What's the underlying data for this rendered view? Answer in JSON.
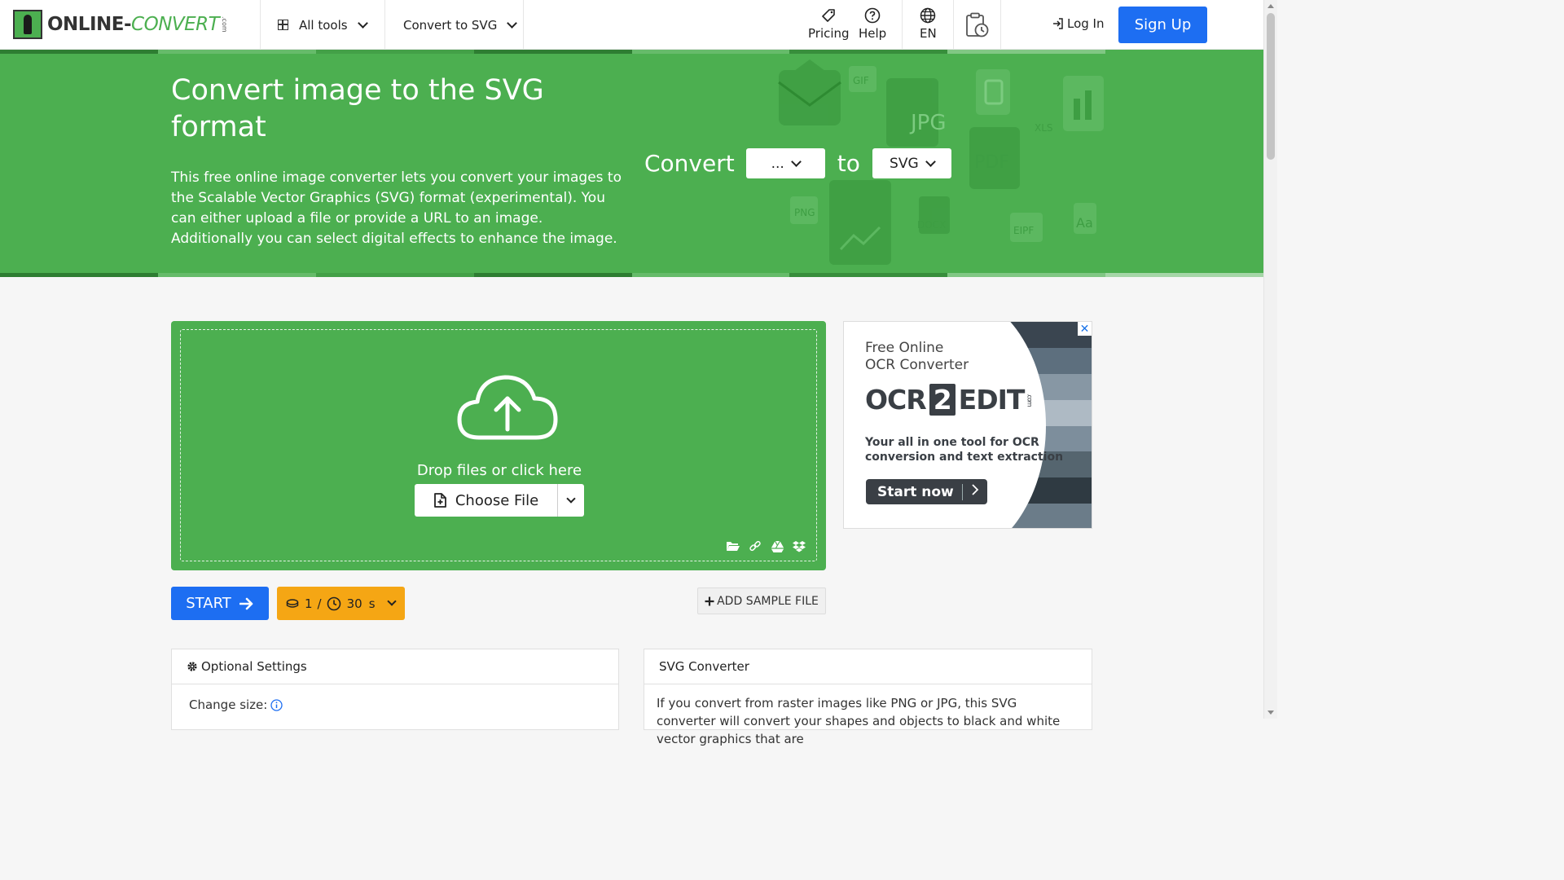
{
  "header": {
    "logo_text_a": "ONLINE-",
    "logo_text_b": "CONVERT",
    "logo_com": ".com",
    "all_tools": "All tools",
    "convert_to": "Convert to SVG",
    "pricing": "Pricing",
    "help": "Help",
    "language": "EN",
    "login": "Log In",
    "signup": "Sign Up"
  },
  "hero": {
    "title": "Convert image to the SVG format",
    "description": "This free online image converter lets you convert your images to the Scalable Vector Graphics (SVG) format (experimental). You can either upload a file or provide a URL to an image. Additionally you can select digital effects to enhance the image.",
    "convert_label": "Convert",
    "from_value": "...",
    "to_label": "to",
    "to_value": "SVG",
    "deco_labels": [
      "GIF",
      "JPG",
      "XLS",
      "PDF",
      "PNG",
      "DOCX",
      "EIPF",
      "Aa"
    ],
    "bg_color": "#4caf50"
  },
  "upload": {
    "drop_text": "Drop files or click here",
    "choose_file": "Choose File"
  },
  "ad": {
    "top_line1": "Free Online",
    "top_line2": "OCR Converter",
    "brand_a": "OCR",
    "brand_b": "2",
    "brand_c": "EDIT",
    "brand_com": ".com",
    "tagline1": "Your all in one tool for OCR",
    "tagline2": "conversion and text extraction",
    "cta": "Start now",
    "close": "✕"
  },
  "actions": {
    "start": "START",
    "credits_count": "1",
    "credits_sep": "/",
    "time_value": "30",
    "time_unit": "s",
    "add_sample": "ADD SAMPLE FILE"
  },
  "settings_panel": {
    "title": "Optional Settings",
    "change_size_label": "Change size:"
  },
  "info_panel": {
    "title": "SVG Converter",
    "text": "If you convert from raster images like PNG or JPG, this SVG converter will convert your shapes and objects to black and white vector graphics that are"
  },
  "colors": {
    "brand_green": "#4caf50",
    "primary_blue": "#1d6ef2",
    "credits_orange": "#f5a614"
  }
}
